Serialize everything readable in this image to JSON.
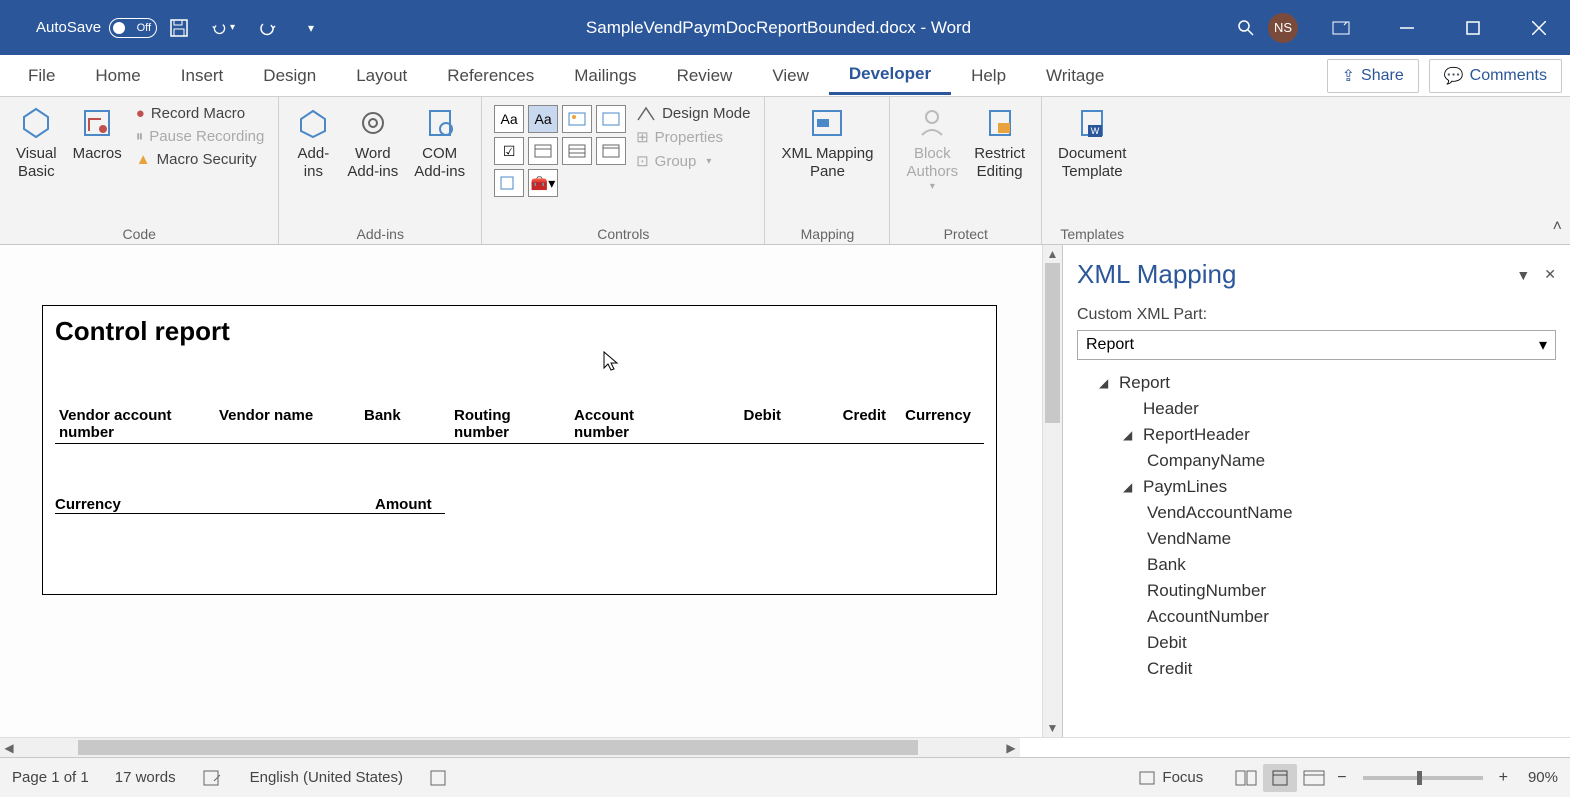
{
  "titlebar": {
    "autosave_label": "AutoSave",
    "autosave_state": "Off",
    "document_title": "SampleVendPaymDocReportBounded.docx - Word",
    "user_initials": "NS"
  },
  "tabs": {
    "file": "File",
    "home": "Home",
    "insert": "Insert",
    "design": "Design",
    "layout": "Layout",
    "references": "References",
    "mailings": "Mailings",
    "review": "Review",
    "view": "View",
    "developer": "Developer",
    "help": "Help",
    "writage": "Writage",
    "share": "Share",
    "comments": "Comments"
  },
  "ribbon": {
    "code": {
      "label": "Code",
      "visual_basic": "Visual\nBasic",
      "macros": "Macros",
      "record_macro": "Record Macro",
      "pause_recording": "Pause Recording",
      "macro_security": "Macro Security"
    },
    "addins": {
      "label": "Add-ins",
      "add_ins": "Add-\nins",
      "word_addins": "Word\nAdd-ins",
      "com_addins": "COM\nAdd-ins"
    },
    "controls": {
      "label": "Controls",
      "design_mode": "Design Mode",
      "properties": "Properties",
      "group": "Group"
    },
    "mapping": {
      "label": "Mapping",
      "xml_mapping_pane": "XML Mapping\nPane"
    },
    "protect": {
      "label": "Protect",
      "block_authors": "Block\nAuthors",
      "restrict_editing": "Restrict\nEditing"
    },
    "templates": {
      "label": "Templates",
      "document_template": "Document\nTemplate"
    }
  },
  "document": {
    "title": "Control report",
    "columns": {
      "vendor_account": "Vendor account number",
      "vendor_name": "Vendor name",
      "bank": "Bank",
      "routing": "Routing number",
      "account": "Account number",
      "debit": "Debit",
      "credit": "Credit",
      "currency": "Currency"
    },
    "sub": {
      "currency": "Currency",
      "amount": "Amount"
    }
  },
  "xml_pane": {
    "title": "XML Mapping",
    "label": "Custom XML Part:",
    "selected": "Report",
    "tree": {
      "report": "Report",
      "header": "Header",
      "report_header": "ReportHeader",
      "company_name": "CompanyName",
      "paym_lines": "PaymLines",
      "vend_account_name": "VendAccountName",
      "vend_name": "VendName",
      "bank": "Bank",
      "routing_number": "RoutingNumber",
      "account_number": "AccountNumber",
      "debit": "Debit",
      "credit": "Credit"
    }
  },
  "statusbar": {
    "page": "Page 1 of 1",
    "words": "17 words",
    "language": "English (United States)",
    "focus": "Focus",
    "zoom": "90%"
  }
}
